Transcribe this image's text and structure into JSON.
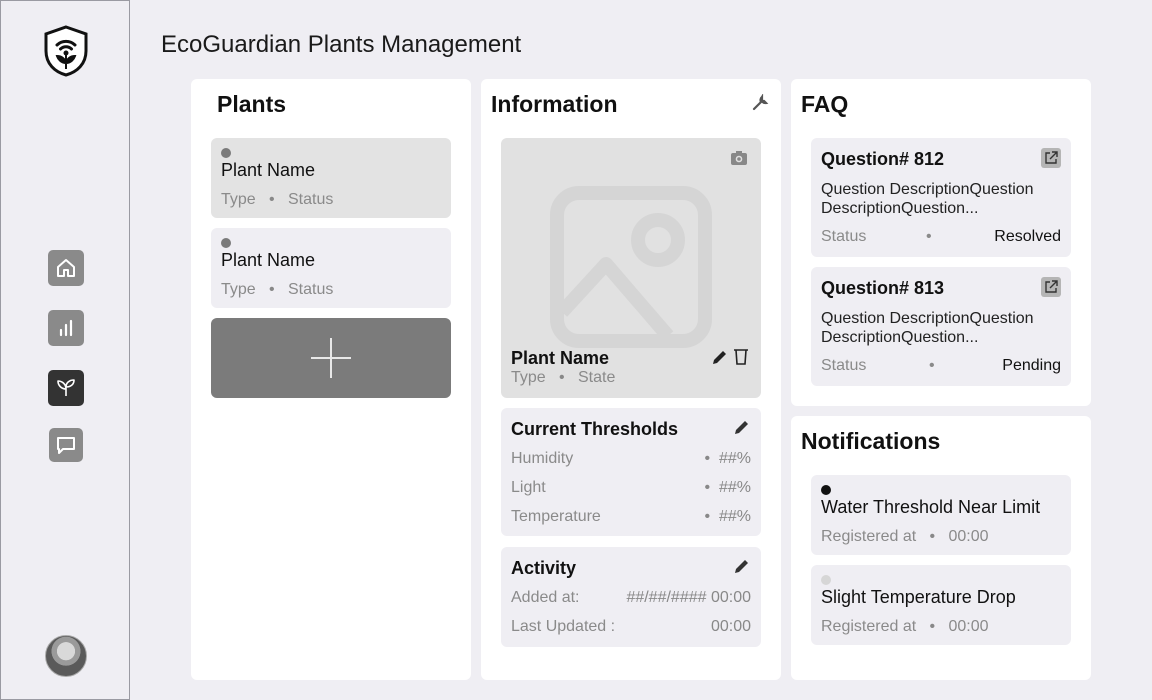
{
  "app": {
    "title": "EcoGuardian Plants Management"
  },
  "sidebar": {
    "nav": [
      {
        "icon": "home-icon"
      },
      {
        "icon": "bar-chart-icon"
      },
      {
        "icon": "sprout-icon",
        "active": true
      },
      {
        "icon": "chat-icon"
      }
    ]
  },
  "plants": {
    "title": "Plants",
    "items": [
      {
        "name": "Plant Name",
        "type": "Type",
        "status": "Status"
      },
      {
        "name": "Plant Name",
        "type": "Type",
        "status": "Status"
      }
    ],
    "add_icon": "plus-icon"
  },
  "information": {
    "title": "Information",
    "plant": {
      "name": "Plant Name",
      "type": "Type",
      "state": "State"
    },
    "thresholds": {
      "title": "Current Thresholds",
      "rows": [
        {
          "label": "Humidity",
          "value": "##%"
        },
        {
          "label": "Light",
          "value": "##%"
        },
        {
          "label": "Temperature",
          "value": "##%"
        }
      ]
    },
    "activity": {
      "title": "Activity",
      "rows": [
        {
          "label": "Added at:",
          "value": "##/##/#### 00:00"
        },
        {
          "label": "Last Updated :",
          "value": "00:00"
        }
      ]
    }
  },
  "faq": {
    "title": "FAQ",
    "items": [
      {
        "title": "Question# 812",
        "description": "Question DescriptionQuestion DescriptionQuestion...",
        "status_label": "Status",
        "status": "Resolved"
      },
      {
        "title": "Question# 813",
        "description": "Question DescriptionQuestion DescriptionQuestion...",
        "status_label": "Status",
        "status": "Pending"
      }
    ]
  },
  "notifications": {
    "title": "Notifications",
    "items": [
      {
        "title": "Water Threshold Near Limit",
        "meta": "Registered at",
        "time": "00:00",
        "dot_color": "#111111"
      },
      {
        "title": "Slight Temperature Drop",
        "meta": "Registered at",
        "time": "00:00",
        "dot_color": "#d6d6d6"
      }
    ]
  },
  "colors": {
    "accent_dark": "#333333",
    "nav_gray": "#8a8a8a",
    "card_bg": "#efeef3",
    "add_button": "#7b7b7b"
  }
}
